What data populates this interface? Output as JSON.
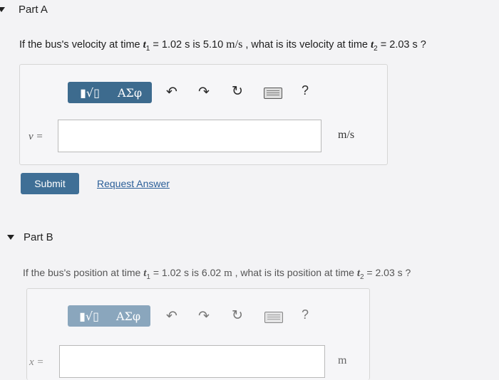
{
  "part_a": {
    "heading": "Part A",
    "question": {
      "prefix": "If the bus's velocity at time ",
      "t1": "t",
      "t1_sub": "1",
      "mid1": " = 1.02 s is 5.10 ",
      "unit1": "m/s",
      "mid2": " , what is its velocity at time ",
      "t2": "t",
      "t2_sub": "2",
      "suffix": " = 2.03 s ?"
    },
    "toolbar": {
      "templates_label": "▮√▯",
      "greek_label": "ΑΣφ",
      "help_label": "?"
    },
    "input_label": "v =",
    "input_value": "",
    "unit": "m/s",
    "submit_label": "Submit",
    "request_label": "Request Answer"
  },
  "part_b": {
    "heading": "Part B",
    "question": {
      "prefix": "If the bus's position at time ",
      "t1": "t",
      "t1_sub": "1",
      "mid1": " = 1.02 s is 6.02 ",
      "unit1": "m",
      "mid2": " , what is its position at time ",
      "t2": "t",
      "t2_sub": "2",
      "suffix": " = 2.03 s ?"
    },
    "toolbar": {
      "templates_label": "▮√▯",
      "greek_label": "ΑΣφ",
      "help_label": "?"
    },
    "input_label": "x =",
    "input_value": "",
    "unit": "m"
  },
  "icons": [
    "undo-icon",
    "redo-icon",
    "reset-icon",
    "keyboard-icon",
    "collapse-caret-icon"
  ]
}
